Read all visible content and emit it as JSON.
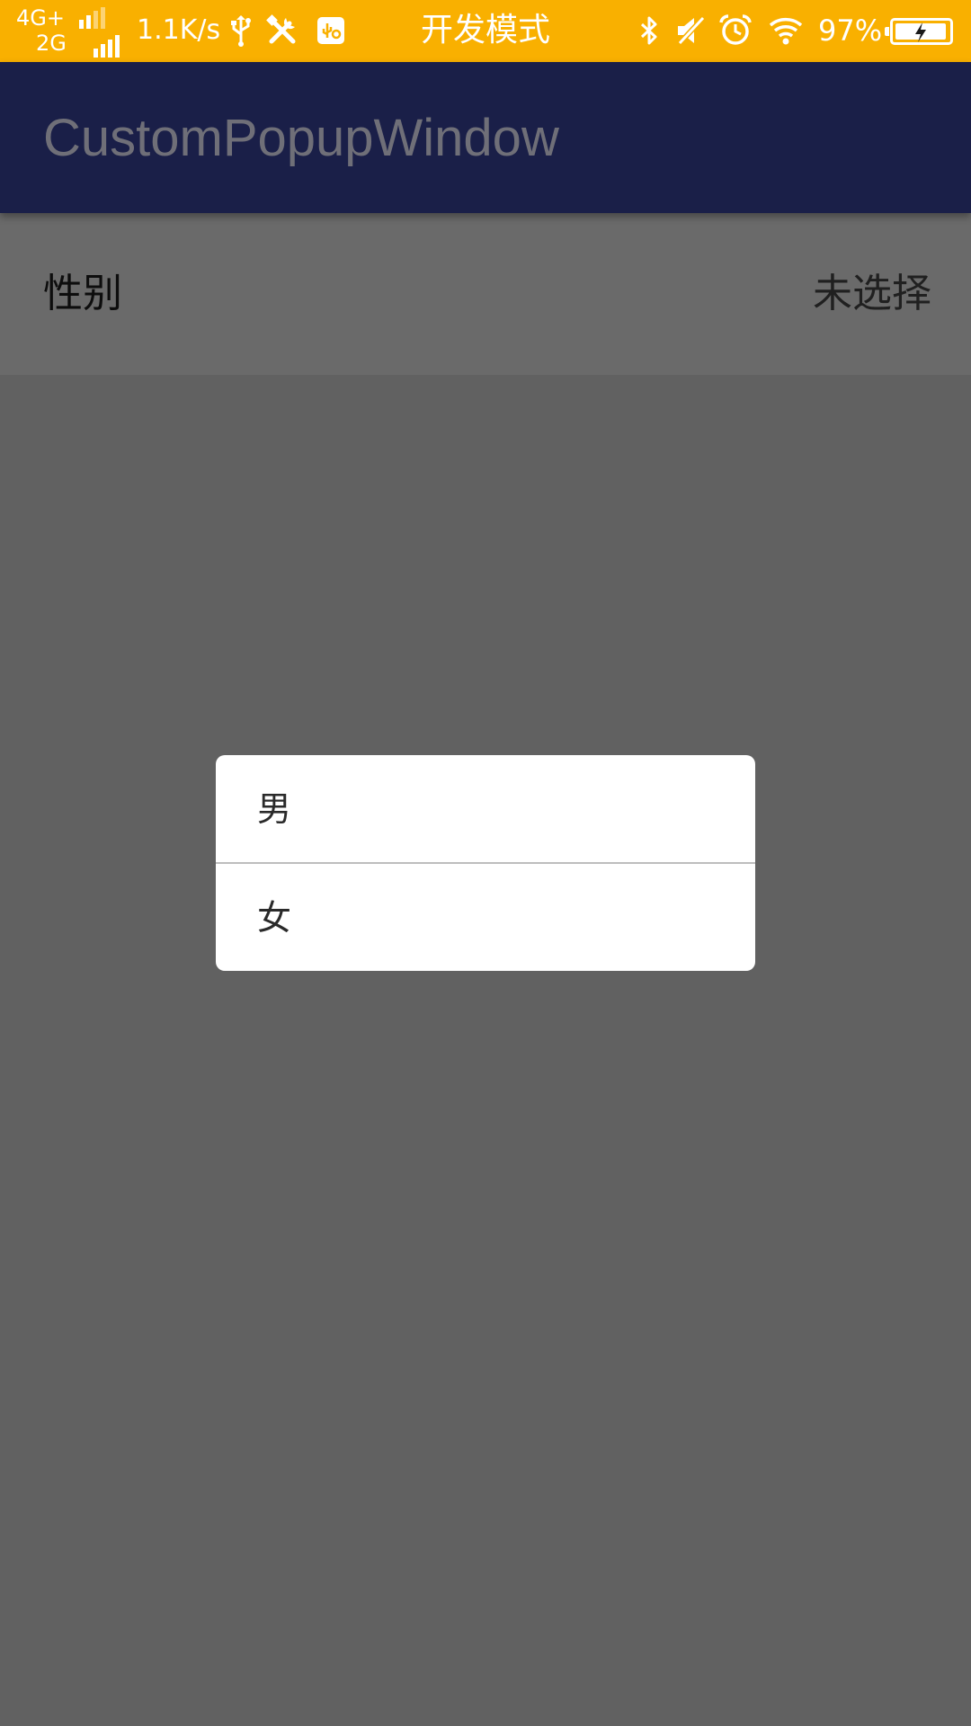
{
  "status_bar": {
    "network_top": "4G+",
    "network_bottom": "2G",
    "speed": "1.1K/s",
    "center_text": "开发模式",
    "battery_percent": "97%",
    "battery_level": 0.97,
    "background": "#f9b000",
    "icons": [
      "usb-icon",
      "tools-icon",
      "usb-debug-icon",
      "bluetooth-icon",
      "mute-icon",
      "alarm-icon",
      "wifi-icon",
      "battery-icon"
    ]
  },
  "app_bar": {
    "title": "CustomPopupWindow",
    "background": "#1a1f48"
  },
  "setting": {
    "label": "性别",
    "value": "未选择"
  },
  "popup": {
    "options": [
      "男",
      "女"
    ]
  }
}
